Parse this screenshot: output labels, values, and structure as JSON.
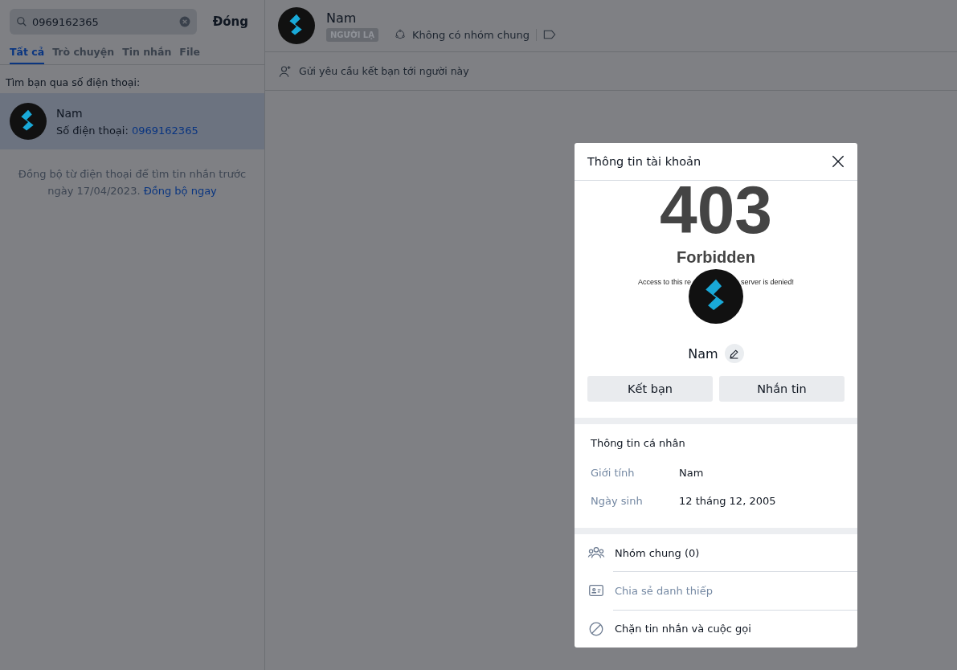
{
  "sidebar": {
    "search": {
      "value": "0969162365"
    },
    "close_label": "Đóng",
    "tabs": [
      {
        "label": "Tất cả",
        "selected": true
      },
      {
        "label": "Trò chuyện",
        "selected": false
      },
      {
        "label": "Tin nhắn",
        "selected": false
      },
      {
        "label": "File",
        "selected": false
      }
    ],
    "section_title": "Tìm bạn qua số điện thoại:",
    "results": [
      {
        "name": "Nam",
        "phone_label": "Số điện thoại:",
        "phone": "0969162365",
        "selected": true
      }
    ],
    "sync_note": "Đồng bộ từ điện thoại để tìm tin nhắn trước ngày 17/04/2023.",
    "sync_link": "Đồng bộ ngay"
  },
  "chat_header": {
    "name": "Nam",
    "badge": "NGƯỜI LẠ",
    "groups": "Không có nhóm chung",
    "friend_request": "Gửi yêu cầu kết bạn tới người này"
  },
  "dialog": {
    "title": "Thông tin tài khoản",
    "error_page": {
      "code": "403",
      "title": "Forbidden",
      "message_left": "Access to this re",
      "message_right": "server is denied!"
    },
    "name": "Nam",
    "buttons": [
      {
        "label": "Kết bạn"
      },
      {
        "label": "Nhắn tin"
      }
    ],
    "personal": {
      "title": "Thông tin cá nhân",
      "fields": [
        {
          "label": "Giới tính",
          "value": "Nam"
        },
        {
          "label": "Ngày sinh",
          "value": "12 tháng 12, 2005"
        }
      ]
    },
    "actions": [
      {
        "kind": "groups",
        "label": "Nhóm chung (0)",
        "muted": false
      },
      {
        "kind": "card",
        "label": "Chia sẻ danh thiếp",
        "muted": true
      },
      {
        "kind": "block",
        "label": "Chặn tin nhắn và cuộc gọi",
        "muted": false
      }
    ]
  }
}
